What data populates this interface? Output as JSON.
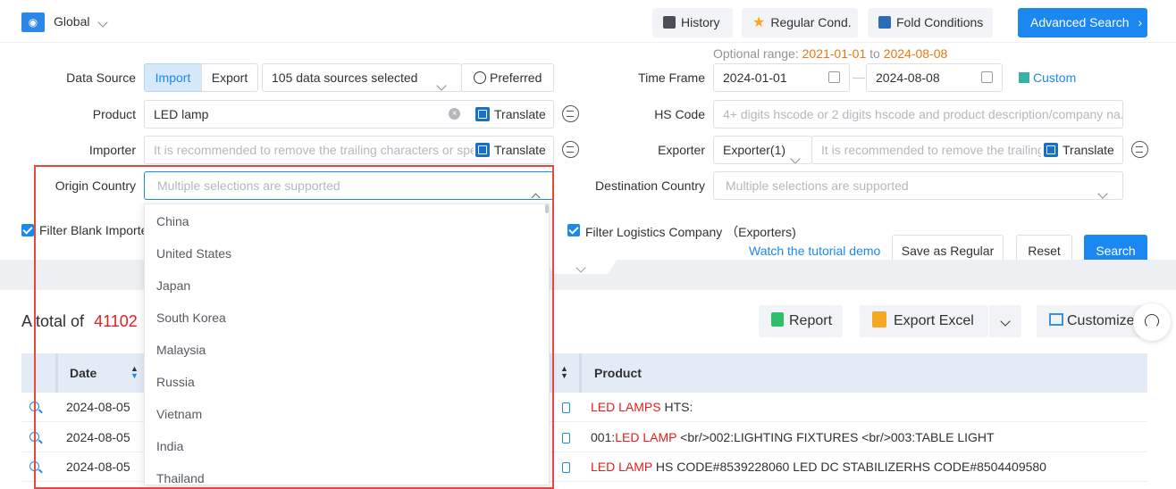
{
  "top": {
    "scope_label": "Global",
    "history": "History",
    "regular_cond": "Regular Cond.",
    "fold": "Fold Conditions",
    "advanced": "Advanced Search"
  },
  "optional": {
    "label": "Optional range:",
    "start": "2021-01-01",
    "to": "to",
    "end": "2024-08-08"
  },
  "form": {
    "data_source_label": "Data Source",
    "import": "Import",
    "export": "Export",
    "sources_selected": "105 data sources selected",
    "preferred": "Preferred",
    "time_frame_label": "Time Frame",
    "date_from": "2024-01-01",
    "date_sep": "—",
    "date_to": "2024-08-08",
    "custom": "Custom",
    "product_label": "Product",
    "product_value": "LED lamp",
    "translate": "Translate",
    "hs_label": "HS Code",
    "hs_placeholder": "4+ digits hscode or 2 digits hscode and product description/company na...",
    "importer_label": "Importer",
    "importer_placeholder": "It is recommended to remove the trailing characters or spe",
    "exporter_label": "Exporter",
    "exporter_select": "Exporter(1)",
    "exporter_placeholder": "It is recommended to remove the trailing",
    "origin_label": "Origin Country",
    "origin_placeholder": "Multiple selections are supported",
    "dest_label": "Destination Country",
    "dest_placeholder": "Multiple selections are supported",
    "filter_blank": "Filter Blank Importe",
    "filter_logistics": "Filter Logistics Company （Exporters)",
    "tutorial": "Watch the tutorial demo",
    "save_regular": "Save as Regular",
    "reset": "Reset",
    "search": "Search"
  },
  "results": {
    "total_prefix": "A total of",
    "total_count": "41102",
    "report": "Report",
    "export_excel": "Export Excel",
    "customize": "Customize"
  },
  "table": {
    "col_date": "Date",
    "col_product": "Product",
    "rows": [
      {
        "date": "2024-08-05",
        "hl": "LED LAMPS",
        "rest": " HTS:",
        "pre": ""
      },
      {
        "date": "2024-08-05",
        "pre": "001:",
        "hl": "LED LAMP",
        "rest": " <br/>002:LIGHTING FIXTURES <br/>003:TABLE LIGHT"
      },
      {
        "date": "2024-08-05",
        "pre": "",
        "hl": "LED LAMP",
        "rest": " HS CODE#8539228060 LED DC STABILIZERHS CODE#8504409580"
      }
    ]
  },
  "dropdown": [
    "China",
    "United States",
    "Japan",
    "South Korea",
    "Malaysia",
    "Russia",
    "Vietnam",
    "India",
    "Thailand"
  ]
}
